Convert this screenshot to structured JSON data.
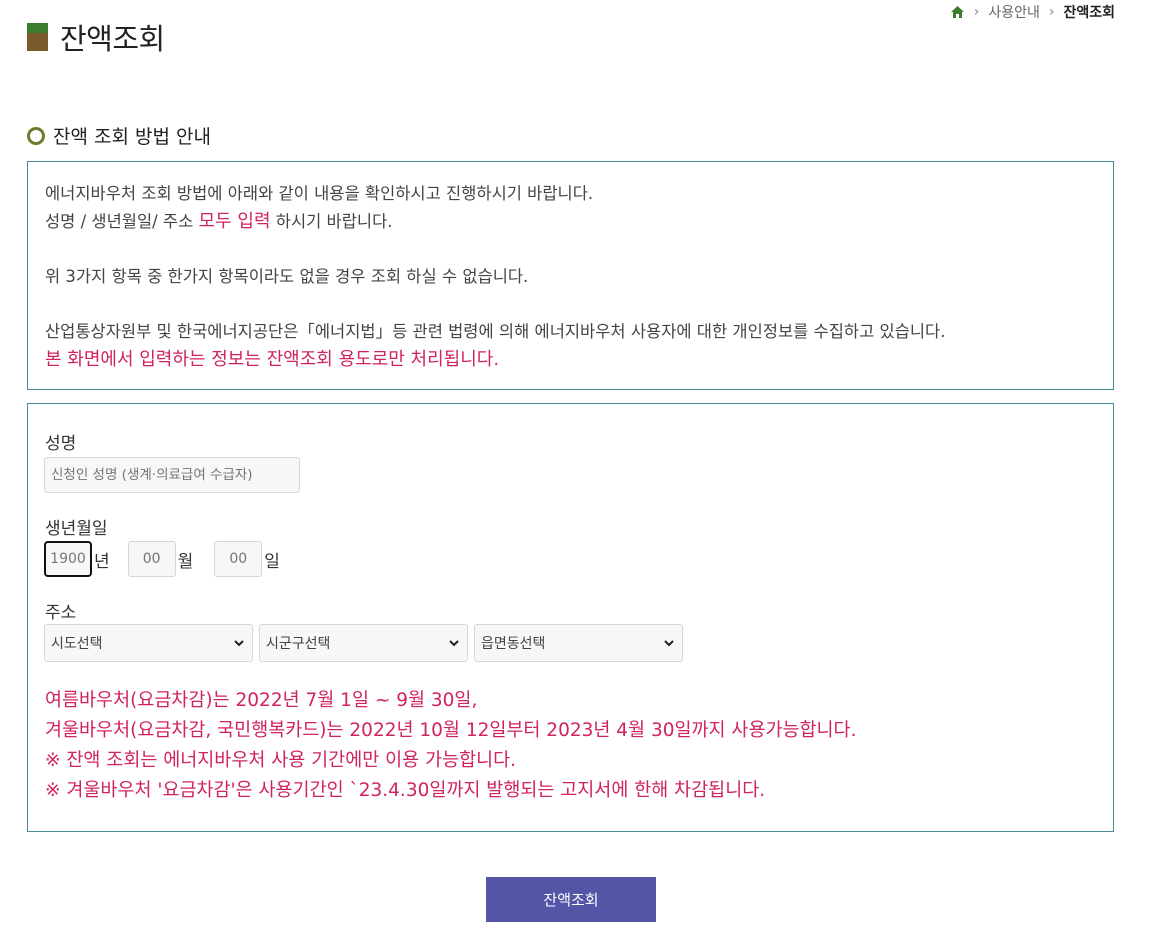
{
  "breadcrumb": {
    "home_icon": "home-icon",
    "items": [
      "사용안내",
      "잔액조회"
    ]
  },
  "page": {
    "title": "잔액조회",
    "section_title": "잔액 조회 방법 안내"
  },
  "info": {
    "line1": "에너지바우처 조회 방법에 아래와 같이 내용을 확인하시고 진행하시기 바랍니다.",
    "line2_prefix": "성명 / 생년월일/ 주소 ",
    "line2_emphasis": "모두 입력",
    "line2_suffix": " 하시기 바랍니다.",
    "line3": "위 3가지 항목 중 한가지 항목이라도 없을 경우 조회 하실 수 없습니다.",
    "line4": "산업통상자원부 및 한국에너지공단은「에너지법」등 관련 법령에 의해 에너지바우처 사용자에 대한 개인정보를 수집하고 있습니다.",
    "line5": "본 화면에서 입력하는 정보는 잔액조회 용도로만 처리됩니다."
  },
  "form": {
    "name_label": "성명",
    "name_placeholder": "신청인 성명 (생계·의료급여 수급자)",
    "birth_label": "생년월일",
    "year_value": "1900",
    "year_unit": "년",
    "month_placeholder": "00",
    "month_unit": "월",
    "day_placeholder": "00",
    "day_unit": "일",
    "address_label": "주소",
    "sido_selected": "시도선택",
    "sigungu_selected": "시군구선택",
    "eup_selected": "읍면동선택"
  },
  "notice": {
    "line1": "여름바우처(요금차감)는 2022년 7월 1일 ~ 9월 30일,",
    "line2": "겨울바우처(요금차감, 국민행복카드)는 2022년 10월 12일부터 2023년 4월 30일까지 사용가능합니다.",
    "line3": "※ 잔액 조회는 에너지바우처 사용 기간에만 이용 가능합니다.",
    "line4": "※ 겨울바우처 '요금차감'은 사용기간인 `23.4.30일까지 발행되는 고지서에 한해 차감됩니다."
  },
  "actions": {
    "submit_label": "잔액조회"
  },
  "colors": {
    "accent_red": "#d0245a",
    "button_bg": "#5555a8",
    "box_border": "#4a8a9a",
    "icon_green": "#3a7d2e",
    "icon_brown": "#7a5a2a"
  }
}
